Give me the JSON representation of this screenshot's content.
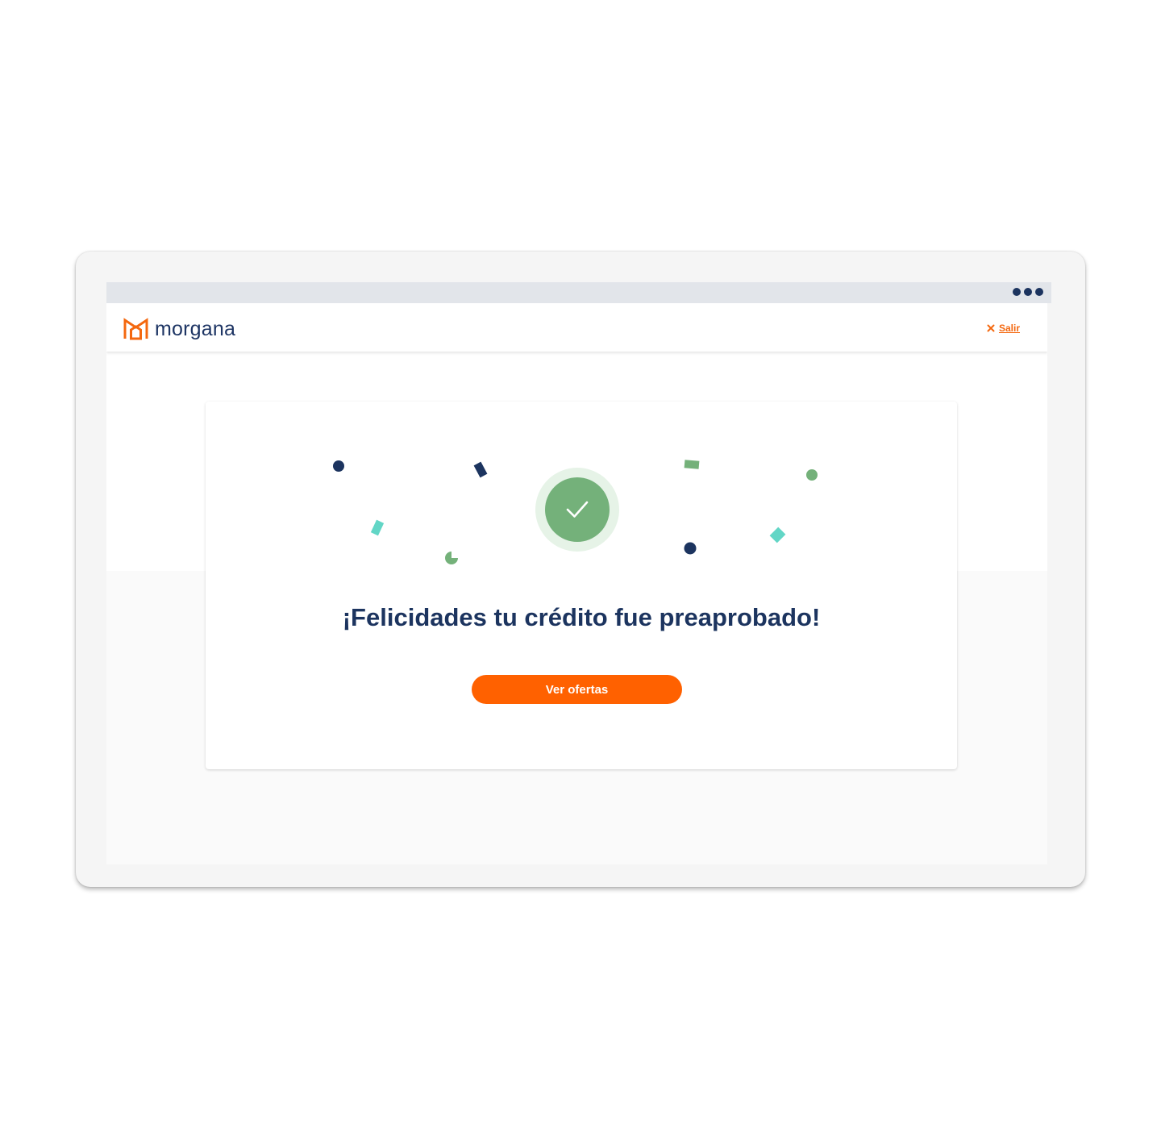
{
  "browser": {
    "menu_icon": "more-dots-icon",
    "colors": {
      "dots": "#1c345f",
      "bar": "#e2e5ea"
    }
  },
  "header": {
    "logo_text": "morgana",
    "logo_icon": "morgana-house-logo-icon",
    "exit_label": "Salir",
    "exit_icon": "close-icon"
  },
  "success": {
    "icon": "check-circle-icon",
    "title": "¡Felicidades tu crédito fue preaprobado!",
    "cta_label": "Ver ofertas"
  },
  "colors": {
    "brand_orange": "#ff6100",
    "navy": "#1c345f",
    "success_green": "#74b17a",
    "success_green_light": "#e6f3e7",
    "confetti_teal": "#62d6c6"
  }
}
